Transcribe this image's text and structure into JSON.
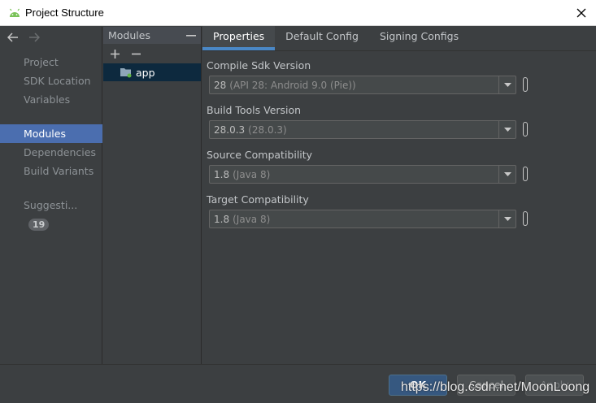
{
  "window": {
    "title": "Project Structure"
  },
  "nav": {
    "items": [
      {
        "label": "Project"
      },
      {
        "label": "SDK Location"
      },
      {
        "label": "Variables"
      },
      {
        "label": "Modules"
      },
      {
        "label": "Dependencies"
      },
      {
        "label": "Build Variants"
      },
      {
        "label": "Suggesti..."
      }
    ],
    "selected": "Modules",
    "suggestions_count": "19"
  },
  "modules": {
    "header": "Modules",
    "items": [
      {
        "label": "app"
      }
    ]
  },
  "tabs": [
    {
      "label": "Properties"
    },
    {
      "label": "Default Config"
    },
    {
      "label": "Signing Configs"
    }
  ],
  "properties": {
    "compile_sdk": {
      "label": "Compile Sdk Version",
      "value": "28",
      "detail": "(API 28: Android 9.0 (Pie))"
    },
    "build_tools": {
      "label": "Build Tools Version",
      "value": "28.0.3",
      "detail": "(28.0.3)"
    },
    "source_compat": {
      "label": "Source Compatibility",
      "value": "1.8",
      "detail": "(Java 8)"
    },
    "target_compat": {
      "label": "Target Compatibility",
      "value": "1.8",
      "detail": "(Java 8)"
    }
  },
  "footer": {
    "ok": "OK",
    "cancel": "Cancel",
    "apply": "Apply"
  },
  "watermark": "https://blog.csdn.net/MoonLoong",
  "colors": {
    "accent": "#4b6eaf",
    "tab_underline": "#4a88c7",
    "background": "#3c3f41"
  }
}
